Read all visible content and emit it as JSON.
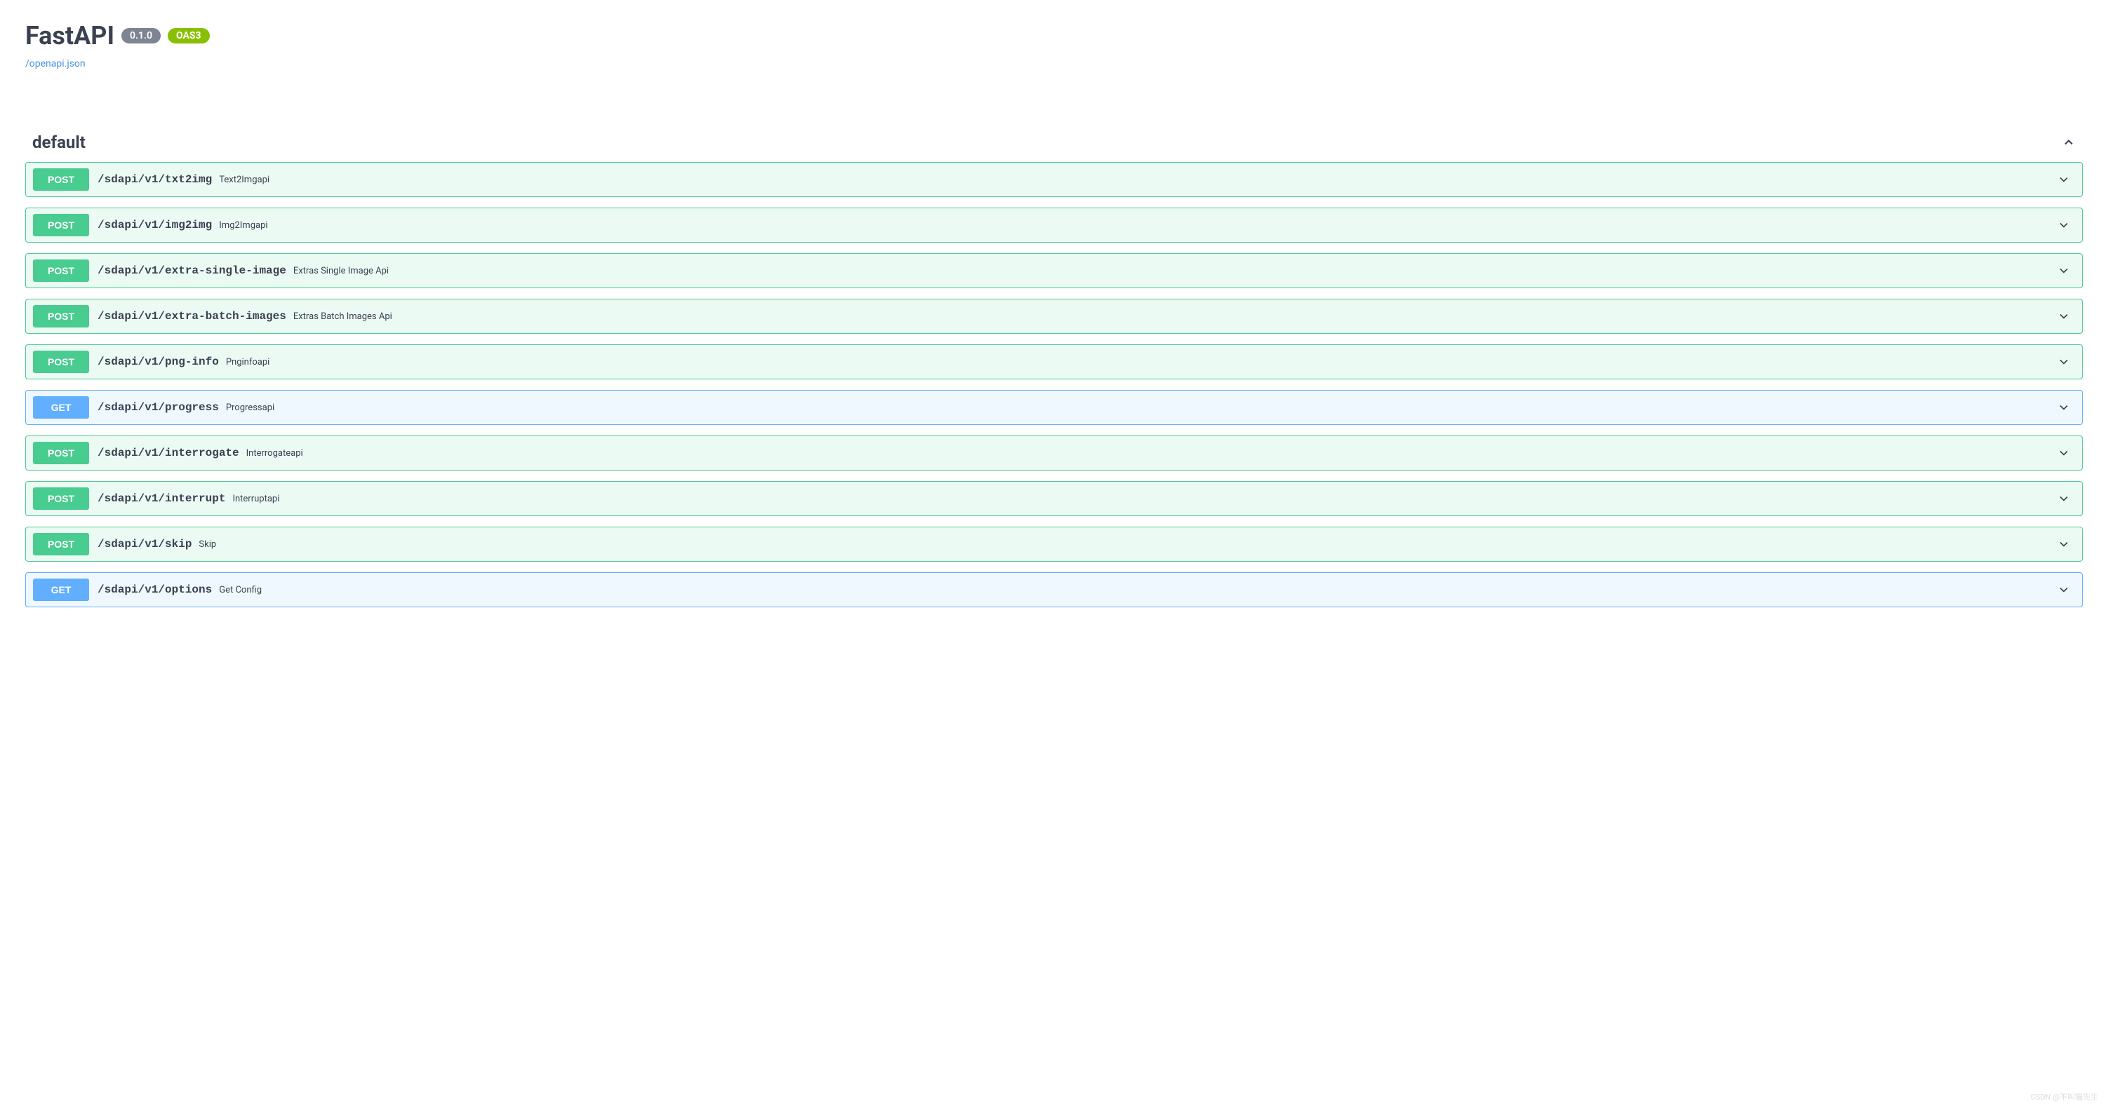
{
  "header": {
    "title": "FastAPI",
    "version": "0.1.0",
    "oas": "OAS3",
    "spec_link": "/openapi.json"
  },
  "section": {
    "name": "default"
  },
  "operations": [
    {
      "method": "POST",
      "path": "/sdapi/v1/txt2img",
      "summary": "Text2Imgapi"
    },
    {
      "method": "POST",
      "path": "/sdapi/v1/img2img",
      "summary": "Img2Imgapi"
    },
    {
      "method": "POST",
      "path": "/sdapi/v1/extra-single-image",
      "summary": "Extras Single Image Api"
    },
    {
      "method": "POST",
      "path": "/sdapi/v1/extra-batch-images",
      "summary": "Extras Batch Images Api"
    },
    {
      "method": "POST",
      "path": "/sdapi/v1/png-info",
      "summary": "Pnginfoapi"
    },
    {
      "method": "GET",
      "path": "/sdapi/v1/progress",
      "summary": "Progressapi"
    },
    {
      "method": "POST",
      "path": "/sdapi/v1/interrogate",
      "summary": "Interrogateapi"
    },
    {
      "method": "POST",
      "path": "/sdapi/v1/interrupt",
      "summary": "Interruptapi"
    },
    {
      "method": "POST",
      "path": "/sdapi/v1/skip",
      "summary": "Skip"
    },
    {
      "method": "GET",
      "path": "/sdapi/v1/options",
      "summary": "Get Config"
    }
  ],
  "watermark": "CSDN @不叫猫先生"
}
